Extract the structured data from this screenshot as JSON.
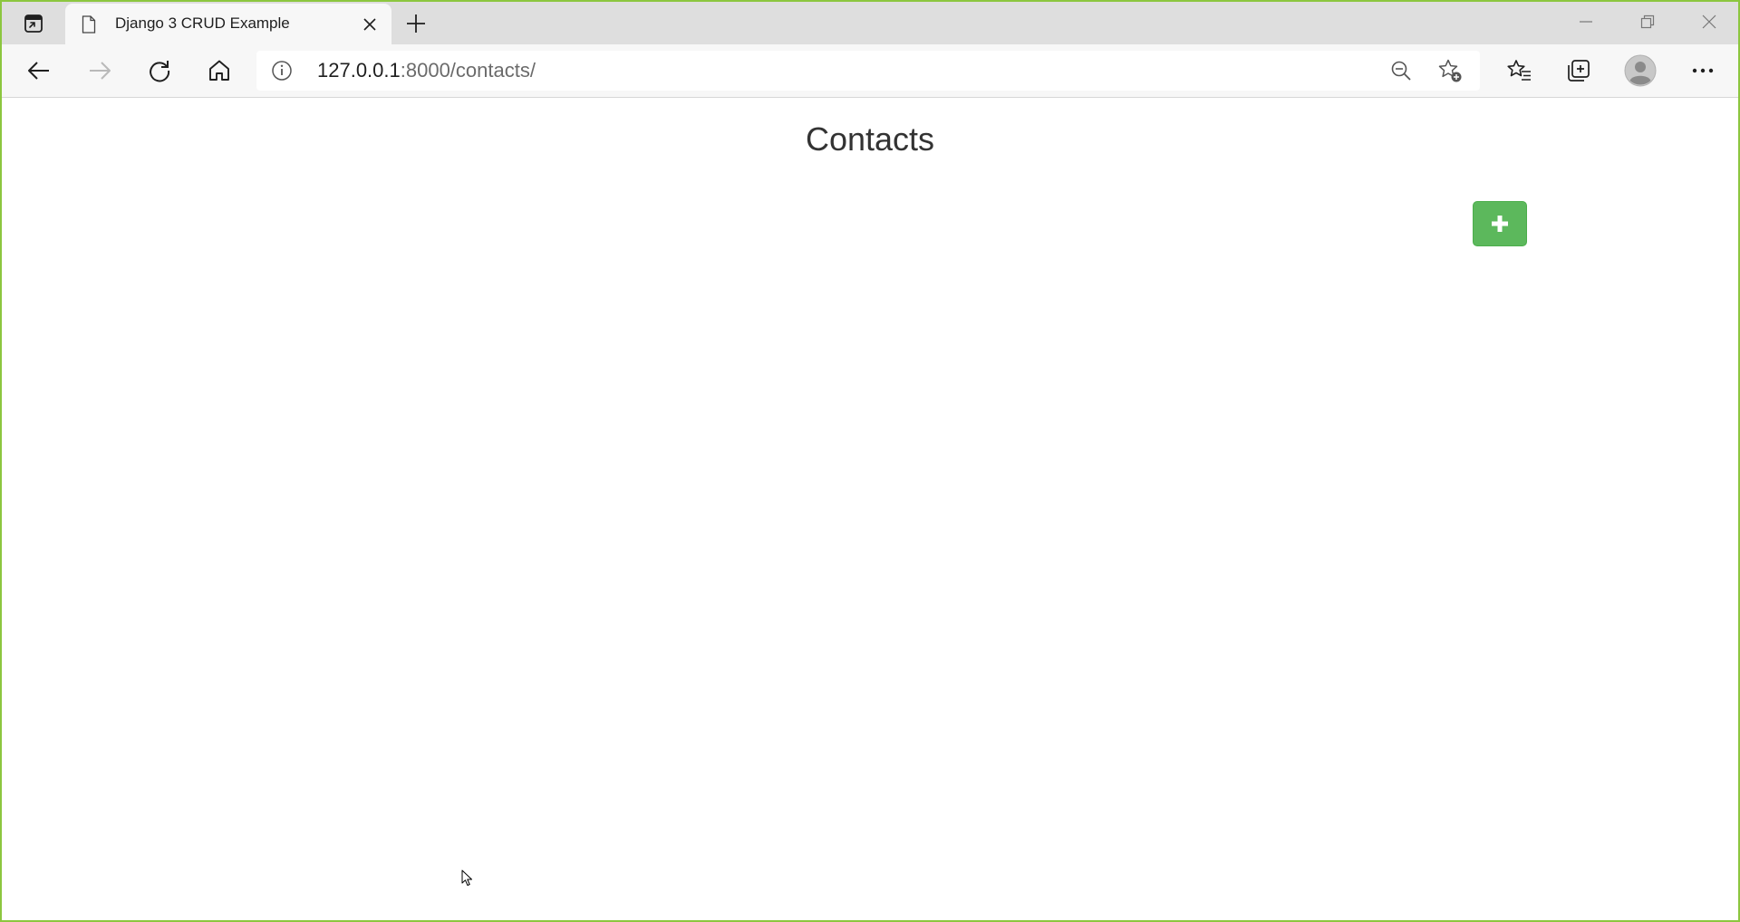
{
  "browser": {
    "tab": {
      "title": "Django 3 CRUD Example",
      "favicon": "page-icon"
    },
    "address_bar": {
      "url_host": "127.0.0.1",
      "url_rest": ":8000/contacts/"
    },
    "icons": {
      "tab_actions": "tab-actions-icon",
      "close_tab": "close-icon",
      "new_tab": "plus-icon",
      "minimize": "minimize-icon",
      "restore": "restore-icon",
      "close_window": "close-icon",
      "back": "arrow-left-icon",
      "forward": "arrow-right-icon",
      "refresh": "refresh-icon",
      "home": "home-icon",
      "site_info": "info-icon",
      "zoom_out": "zoom-out-icon",
      "add_favorite": "star-add-icon",
      "favorites": "favorites-icon",
      "collections": "collections-icon",
      "profile": "avatar-icon",
      "more": "more-icon"
    },
    "colors": {
      "window_border": "#8cc63f",
      "tabstrip": "#dedede",
      "toolbar": "#f7f7f7"
    }
  },
  "page": {
    "title": "Contacts",
    "add_button": {
      "icon": "plus-icon",
      "color": "#5cb85c"
    }
  }
}
